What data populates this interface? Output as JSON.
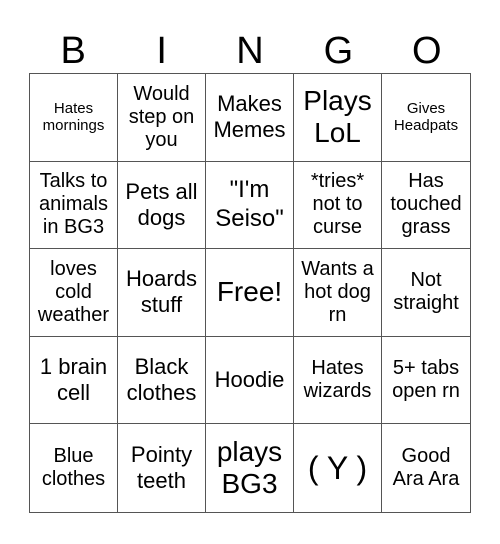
{
  "header": {
    "letters": [
      "B",
      "I",
      "N",
      "G",
      "O"
    ]
  },
  "cells": [
    "Hates mornings",
    "Would step on you",
    "Makes Memes",
    "Plays LoL",
    "Gives Headpats",
    "Talks to animals in BG3",
    "Pets all dogs",
    "\"I'm Seiso\"",
    "*tries* not to curse",
    "Has touched grass",
    "loves cold weather",
    "Hoards stuff",
    "Free!",
    "Wants a hot dog rn",
    "Not straight",
    "1 brain cell",
    "Black clothes",
    "Hoodie",
    "Hates wizards",
    "5+ tabs open rn",
    "Blue clothes",
    "Pointy teeth",
    "plays BG3",
    "( Y )",
    "Good Ara Ara"
  ]
}
